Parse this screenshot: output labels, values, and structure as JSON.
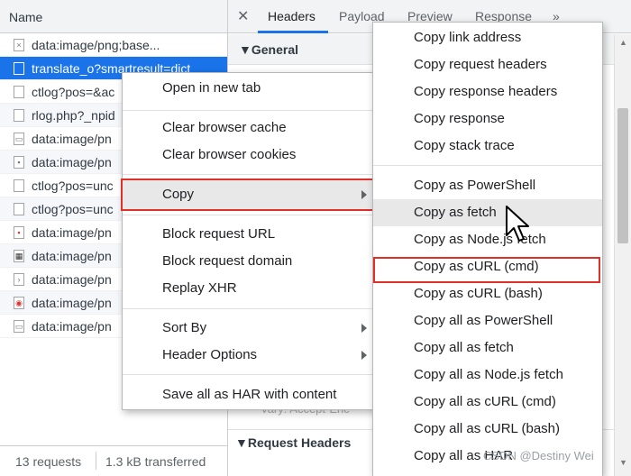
{
  "network": {
    "name_header": "Name",
    "requests": [
      {
        "name": "data:image/png;base...",
        "icon": "image-icon",
        "selected": false
      },
      {
        "name": "translate_o?smartresult=dict",
        "icon": "document-icon",
        "selected": true
      },
      {
        "name": "ctlog?pos=&ac",
        "icon": "document-icon",
        "selected": false
      },
      {
        "name": "rlog.php?_npid",
        "icon": "document-icon",
        "selected": false
      },
      {
        "name": "data:image/pn",
        "icon": "image-icon",
        "selected": false
      },
      {
        "name": "data:image/pn",
        "icon": "image-icon",
        "selected": false
      },
      {
        "name": "ctlog?pos=unc",
        "icon": "document-icon",
        "selected": false
      },
      {
        "name": "ctlog?pos=unc",
        "icon": "document-icon",
        "selected": false
      },
      {
        "name": "data:image/pn",
        "icon": "image-icon",
        "selected": false
      },
      {
        "name": "data:image/pn",
        "icon": "image-icon",
        "selected": false
      },
      {
        "name": "data:image/pn",
        "icon": "image-icon",
        "selected": false
      },
      {
        "name": "data:image/pn",
        "icon": "image-icon",
        "selected": false
      },
      {
        "name": "data:image/pn",
        "icon": "image-icon",
        "selected": false
      }
    ],
    "status": {
      "requests": "13 requests",
      "transferred": "1.3 kB transferred"
    }
  },
  "detail": {
    "close_glyph": "✕",
    "tabs": [
      "Headers",
      "Payload",
      "Preview",
      "Response",
      "»"
    ],
    "general_section": "▼General",
    "request_headers_section": "▼Request Headers",
    "partial_row": "Vary: Accept-Enc"
  },
  "context_menu": {
    "items": [
      {
        "label": "Open in new tab"
      },
      {
        "label": "Clear browser cache"
      },
      {
        "label": "Clear browser cookies"
      },
      {
        "label": "Copy",
        "has_submenu": true,
        "highlighted": true
      },
      {
        "label": "Block request URL"
      },
      {
        "label": "Block request domain"
      },
      {
        "label": "Replay XHR"
      },
      {
        "label": "Sort By",
        "has_submenu": true
      },
      {
        "label": "Header Options",
        "has_submenu": true
      },
      {
        "label": "Save all as HAR with content"
      }
    ]
  },
  "copy_submenu": {
    "items": [
      {
        "label": "Copy link address"
      },
      {
        "label": "Copy request headers"
      },
      {
        "label": "Copy response headers"
      },
      {
        "label": "Copy response"
      },
      {
        "label": "Copy stack trace"
      },
      {
        "label": "Copy as PowerShell"
      },
      {
        "label": "Copy as fetch",
        "hovered": true
      },
      {
        "label": "Copy as Node.js fetch"
      },
      {
        "label": "Copy as cURL (cmd)",
        "highlighted": true
      },
      {
        "label": "Copy as cURL (bash)"
      },
      {
        "label": "Copy all as PowerShell"
      },
      {
        "label": "Copy all as fetch"
      },
      {
        "label": "Copy all as Node.js fetch"
      },
      {
        "label": "Copy all as cURL (cmd)"
      },
      {
        "label": "Copy all as cURL (bash)"
      },
      {
        "label": "Copy all as HAR"
      }
    ]
  },
  "watermark": "CSDN @Destiny Wei",
  "colors": {
    "selection_blue": "#1a73e8",
    "highlight_red": "#e0302a",
    "hover_gray": "#e8e8e8"
  }
}
